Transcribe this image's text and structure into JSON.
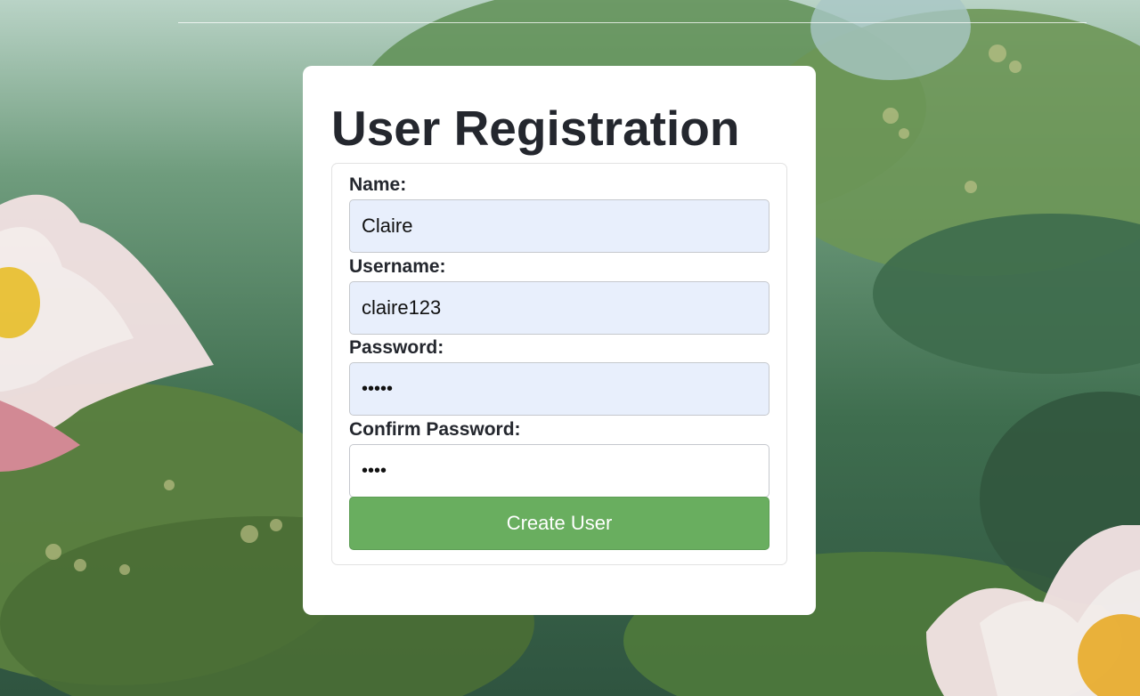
{
  "page": {
    "title": "User Registration"
  },
  "form": {
    "fields": [
      {
        "label": "Name:",
        "value": "Claire",
        "type": "text"
      },
      {
        "label": "Username:",
        "value": "claire123",
        "type": "text"
      },
      {
        "label": "Password:",
        "value": "abcde",
        "type": "password"
      },
      {
        "label": "Confirm Password:",
        "value": "abcd",
        "type": "password"
      }
    ],
    "submit_label": "Create User"
  },
  "colors": {
    "card_background": "#ffffff",
    "autofill_input_background": "#e8effc",
    "submit_button": "#69ae5f",
    "title_text": "#24272e"
  },
  "icons": {
    "background": "water-lily-pond-illustration"
  }
}
